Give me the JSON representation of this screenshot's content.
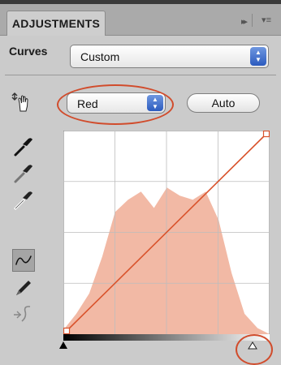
{
  "panel": {
    "tab_title": "ADJUSTMENTS",
    "controls": {
      "collapse": "▸▸",
      "menu": "▾≡"
    }
  },
  "adjustment": {
    "label": "Curves",
    "preset": "Custom"
  },
  "channel": {
    "value": "Red",
    "auto_label": "Auto"
  },
  "icons": {
    "on_image": "hand-pointer-icon",
    "black_point": "black-eyedropper-icon",
    "gray_point": "gray-eyedropper-icon",
    "white_point": "white-eyedropper-icon",
    "curve": "curve-edit-icon",
    "pencil": "pencil-icon",
    "smooth": "smooth-curve-icon"
  },
  "colors": {
    "accent_red": "#d9532c",
    "histogram": "#f2b9a5",
    "highlight_ring": "#d14c2c",
    "select_arrow": "#3a6bd1"
  },
  "chart_data": {
    "type": "area",
    "channel": "Red",
    "x": [
      0,
      16,
      32,
      48,
      64,
      80,
      96,
      112,
      128,
      144,
      160,
      176,
      192,
      208,
      224,
      240,
      255
    ],
    "histogram": [
      2,
      10,
      20,
      38,
      60,
      66,
      70,
      62,
      72,
      68,
      66,
      70,
      56,
      30,
      10,
      3,
      0
    ],
    "xlim": [
      0,
      255
    ],
    "ylim": [
      0,
      100
    ],
    "curve_points": [
      [
        0,
        0
      ],
      [
        255,
        255
      ]
    ],
    "grid": "4x4"
  }
}
